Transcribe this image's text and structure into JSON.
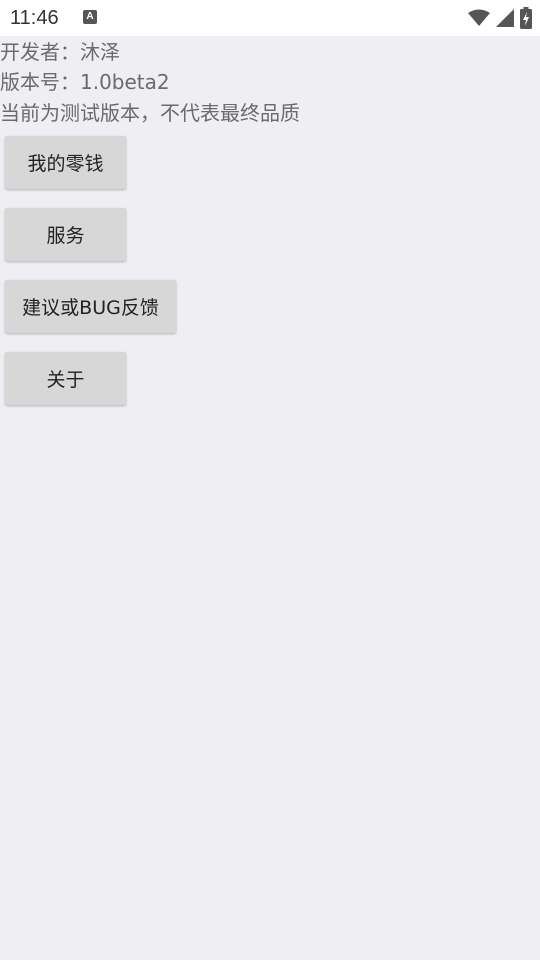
{
  "status_bar": {
    "time": "11:46",
    "notif_icon_letter": "A",
    "icons": [
      "wifi-icon",
      "signal-icon",
      "battery-charging-icon"
    ]
  },
  "info": {
    "developer": "开发者：沐泽",
    "version": "版本号：1.0beta2",
    "note": "当前为测试版本，不代表最终品质"
  },
  "buttons": {
    "change": "我的零钱",
    "service": "服务",
    "feedback": "建议或BUG反馈",
    "about": "关于"
  },
  "colors": {
    "background": "#eeeef3",
    "button": "#d7d7d7",
    "info_text": "#6b6b6b"
  }
}
